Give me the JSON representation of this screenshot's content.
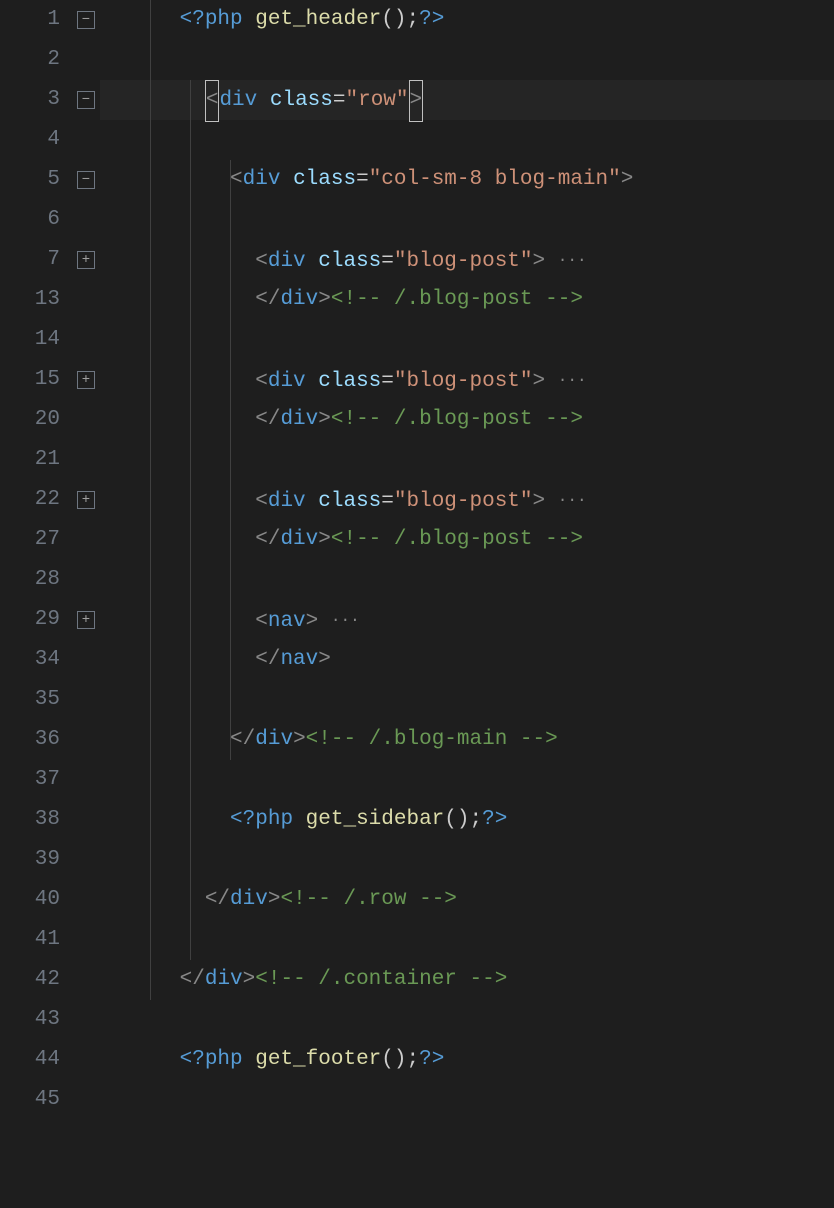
{
  "gutter": {
    "numbers": [
      "1",
      "2",
      "3",
      "4",
      "5",
      "6",
      "7",
      "13",
      "14",
      "15",
      "20",
      "21",
      "22",
      "27",
      "28",
      "29",
      "34",
      "35",
      "36",
      "37",
      "38",
      "39",
      "40",
      "41",
      "42",
      "43",
      "44",
      "45"
    ]
  },
  "fold": {
    "minus": "−",
    "plus": "+",
    "rows": {
      "0": "minus",
      "2": "minus",
      "4": "minus",
      "6": "plus",
      "9": "plus",
      "12": "plus",
      "15": "plus"
    }
  },
  "tokens": {
    "php_open": "<?php",
    "php_close": "?>",
    "fn_header": "get_header",
    "fn_sidebar": "get_sidebar",
    "fn_footer": "get_footer",
    "parens_semi": "();",
    "lt": "<",
    "lt_slash": "</",
    "gt": ">",
    "div": "div",
    "nav": "nav",
    "sp": " ",
    "class_attr": "class",
    "eq": "=",
    "row_str": "\"row\"",
    "colsm_str": "\"col-sm-8 blog-main\"",
    "blogpost_str": "\"blog-post\"",
    "cmt_blogpost": "<!-- /.blog-post -->",
    "cmt_blogmain": "<!-- /.blog-main -->",
    "cmt_row": "<!-- /.row -->",
    "cmt_container": "<!-- /.container -->",
    "ellipsis": "···"
  },
  "indent": {
    "i0": "",
    "i1": "   ",
    "i2": "      ",
    "i3": "         ",
    "i4": "            ",
    "base": "         "
  }
}
